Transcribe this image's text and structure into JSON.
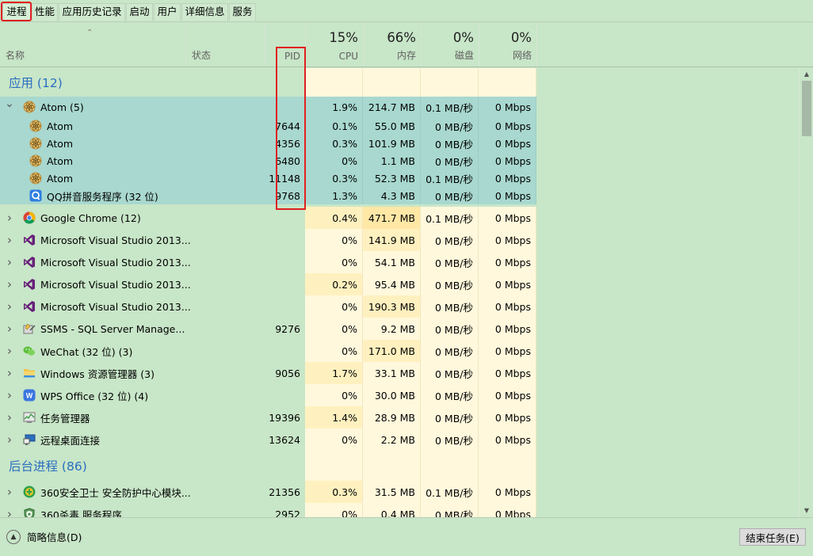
{
  "tabs": [
    {
      "label": "进程"
    },
    {
      "label": "性能"
    },
    {
      "label": "应用历史记录"
    },
    {
      "label": "启动"
    },
    {
      "label": "用户"
    },
    {
      "label": "详细信息"
    },
    {
      "label": "服务"
    }
  ],
  "header": {
    "sort_glyph": "⌃",
    "name": "名称",
    "status": "状态",
    "pid": "PID",
    "cpu_pct": "15%",
    "cpu": "CPU",
    "mem_pct": "66%",
    "mem": "内存",
    "disk_pct": "0%",
    "disk": "磁盘",
    "net_pct": "0%",
    "net": "网络"
  },
  "groups": {
    "apps": "应用 (12)",
    "background": "后台进程 (86)"
  },
  "apps": [
    {
      "name": "Atom (5)",
      "icon": "atom-icon",
      "pid": "",
      "cpu": "1.9%",
      "mem": "214.7 MB",
      "disk": "0.1 MB/秒",
      "net": "0 Mbps",
      "expanded": true
    },
    {
      "name": "Atom",
      "icon": "atom-icon",
      "pid": "7644",
      "cpu": "0.1%",
      "mem": "55.0 MB",
      "disk": "0 MB/秒",
      "net": "0 Mbps",
      "child": true
    },
    {
      "name": "Atom",
      "icon": "atom-icon",
      "pid": "4356",
      "cpu": "0.3%",
      "mem": "101.9 MB",
      "disk": "0 MB/秒",
      "net": "0 Mbps",
      "child": true
    },
    {
      "name": "Atom",
      "icon": "atom-icon",
      "pid": "6480",
      "cpu": "0%",
      "mem": "1.1 MB",
      "disk": "0 MB/秒",
      "net": "0 Mbps",
      "child": true
    },
    {
      "name": "Atom",
      "icon": "atom-icon",
      "pid": "11148",
      "cpu": "0.3%",
      "mem": "52.3 MB",
      "disk": "0.1 MB/秒",
      "net": "0 Mbps",
      "child": true
    },
    {
      "name": "QQ拼音服务程序 (32 位)",
      "icon": "qq-pinyin-icon",
      "pid": "9768",
      "cpu": "1.3%",
      "mem": "4.3 MB",
      "disk": "0 MB/秒",
      "net": "0 Mbps",
      "child": true
    },
    {
      "name": "Google Chrome (12)",
      "icon": "chrome-icon",
      "pid": "",
      "cpu": "0.4%",
      "mem": "471.7 MB",
      "disk": "0.1 MB/秒",
      "net": "0 Mbps"
    },
    {
      "name": "Microsoft Visual Studio 2013...",
      "icon": "visual-studio-icon",
      "pid": "",
      "cpu": "0%",
      "mem": "141.9 MB",
      "disk": "0 MB/秒",
      "net": "0 Mbps"
    },
    {
      "name": "Microsoft Visual Studio 2013...",
      "icon": "visual-studio-icon",
      "pid": "",
      "cpu": "0%",
      "mem": "54.1 MB",
      "disk": "0 MB/秒",
      "net": "0 Mbps"
    },
    {
      "name": "Microsoft Visual Studio 2013...",
      "icon": "visual-studio-icon",
      "pid": "",
      "cpu": "0.2%",
      "mem": "95.4 MB",
      "disk": "0 MB/秒",
      "net": "0 Mbps"
    },
    {
      "name": "Microsoft Visual Studio 2013...",
      "icon": "visual-studio-icon",
      "pid": "",
      "cpu": "0%",
      "mem": "190.3 MB",
      "disk": "0 MB/秒",
      "net": "0 Mbps"
    },
    {
      "name": "SSMS - SQL Server Manage...",
      "icon": "ssms-icon",
      "pid": "9276",
      "cpu": "0%",
      "mem": "9.2 MB",
      "disk": "0 MB/秒",
      "net": "0 Mbps"
    },
    {
      "name": "WeChat (32 位) (3)",
      "icon": "wechat-icon",
      "pid": "",
      "cpu": "0%",
      "mem": "171.0 MB",
      "disk": "0 MB/秒",
      "net": "0 Mbps"
    },
    {
      "name": "Windows 资源管理器 (3)",
      "icon": "explorer-icon",
      "pid": "9056",
      "cpu": "1.7%",
      "mem": "33.1 MB",
      "disk": "0 MB/秒",
      "net": "0 Mbps"
    },
    {
      "name": "WPS Office (32 位) (4)",
      "icon": "wps-icon",
      "pid": "",
      "cpu": "0%",
      "mem": "30.0 MB",
      "disk": "0 MB/秒",
      "net": "0 Mbps"
    },
    {
      "name": "任务管理器",
      "icon": "task-manager-icon",
      "pid": "19396",
      "cpu": "1.4%",
      "mem": "28.9 MB",
      "disk": "0 MB/秒",
      "net": "0 Mbps"
    },
    {
      "name": "远程桌面连接",
      "icon": "remote-desktop-icon",
      "pid": "13624",
      "cpu": "0%",
      "mem": "2.2 MB",
      "disk": "0 MB/秒",
      "net": "0 Mbps"
    }
  ],
  "background": [
    {
      "name": "360安全卫士 安全防护中心模块...",
      "icon": "360-safe-icon",
      "pid": "21356",
      "cpu": "0.3%",
      "mem": "31.5 MB",
      "disk": "0.1 MB/秒",
      "net": "0 Mbps"
    },
    {
      "name": "360杀毒 服务程序",
      "icon": "360-antivirus-icon",
      "pid": "2952",
      "cpu": "0%",
      "mem": "0.4 MB",
      "disk": "0 MB/秒",
      "net": "0 Mbps"
    }
  ],
  "footer": {
    "fewer_details": "简略信息(D)",
    "end_task": "结束任务(E)"
  }
}
